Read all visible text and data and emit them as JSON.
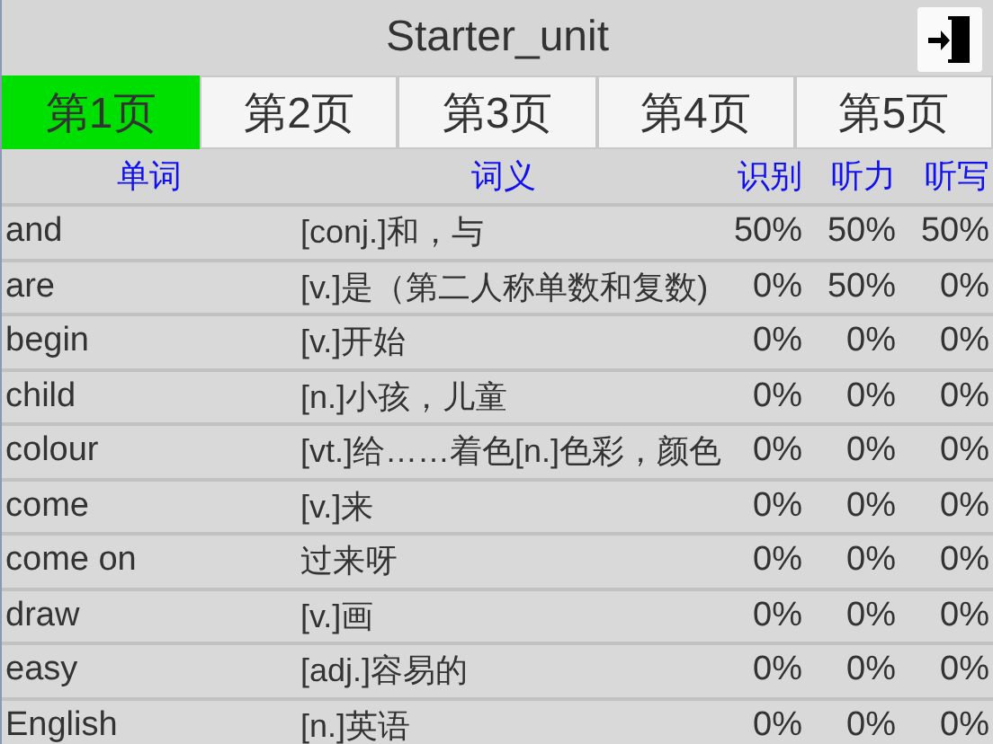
{
  "window": {
    "title": "Starter_unit"
  },
  "tabs": [
    {
      "label": "第1页",
      "selected": true
    },
    {
      "label": "第2页",
      "selected": false
    },
    {
      "label": "第3页",
      "selected": false
    },
    {
      "label": "第4页",
      "selected": false
    },
    {
      "label": "第5页",
      "selected": false
    }
  ],
  "table": {
    "columns": [
      "单词",
      "词义",
      "识别",
      "听力",
      "听写"
    ],
    "rows": [
      {
        "word": "and",
        "meaning": "[conj.]和，与",
        "recognition": "50%",
        "listening": "50%",
        "dictation": "50%"
      },
      {
        "word": "are",
        "meaning": "[v.]是（第二人称单数和复数)",
        "recognition": "0%",
        "listening": "50%",
        "dictation": "0%"
      },
      {
        "word": "begin",
        "meaning": "[v.]开始",
        "recognition": "0%",
        "listening": "0%",
        "dictation": "0%"
      },
      {
        "word": "child",
        "meaning": "[n.]小孩，儿童",
        "recognition": "0%",
        "listening": "0%",
        "dictation": "0%"
      },
      {
        "word": "colour",
        "meaning": "[vt.]给……着色[n.]色彩，颜色",
        "recognition": "0%",
        "listening": "0%",
        "dictation": "0%"
      },
      {
        "word": "come",
        "meaning": "[v.]来",
        "recognition": "0%",
        "listening": "0%",
        "dictation": "0%"
      },
      {
        "word": "come on",
        "meaning": "过来呀",
        "recognition": "0%",
        "listening": "0%",
        "dictation": "0%"
      },
      {
        "word": "draw",
        "meaning": "[v.]画",
        "recognition": "0%",
        "listening": "0%",
        "dictation": "0%"
      },
      {
        "word": "easy",
        "meaning": "[adj.]容易的",
        "recognition": "0%",
        "listening": "0%",
        "dictation": "0%"
      },
      {
        "word": "English",
        "meaning": "[n.]英语",
        "recognition": "0%",
        "listening": "0%",
        "dictation": "0%"
      }
    ]
  }
}
